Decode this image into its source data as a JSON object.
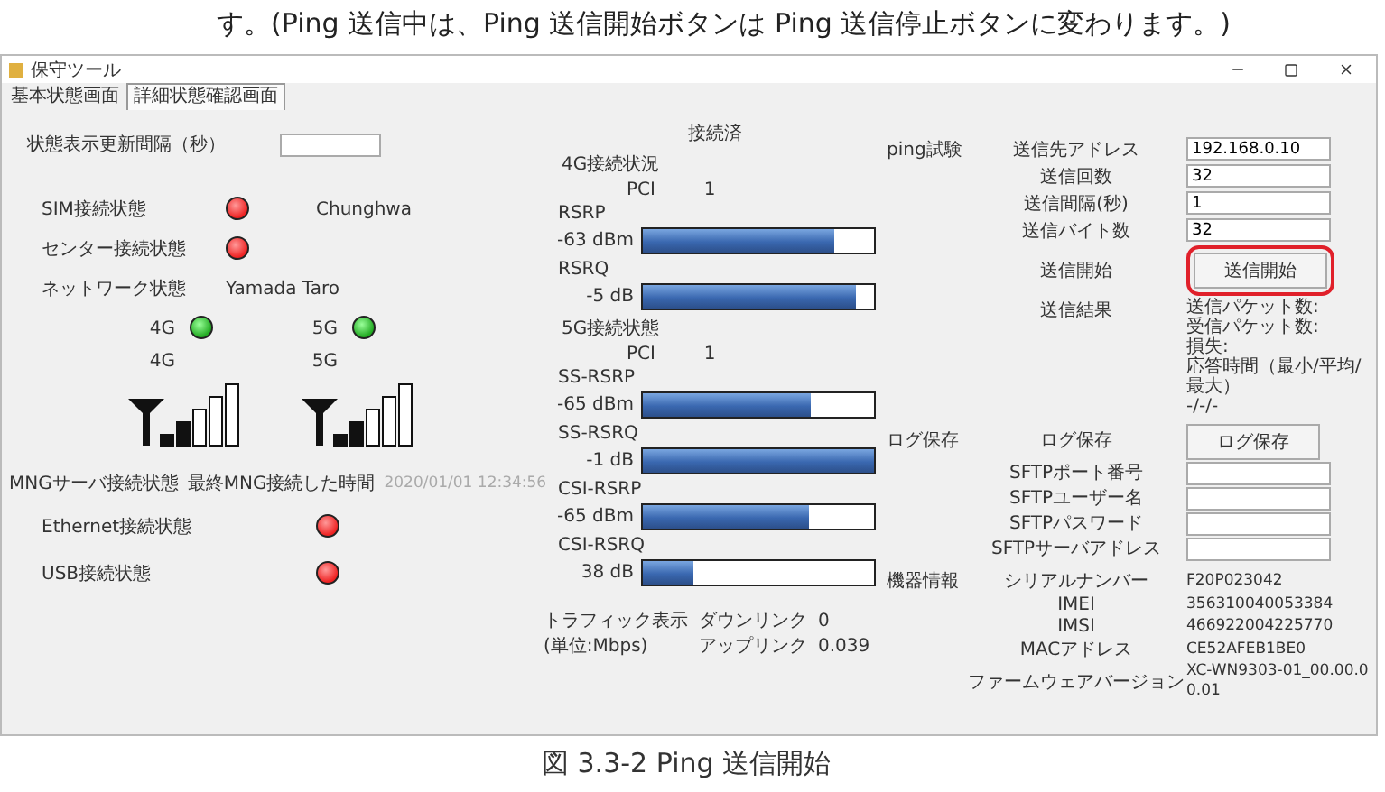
{
  "caption_top": "す。(Ping 送信中は、Ping 送信開始ボタンは Ping 送信停止ボタンに変わります。)",
  "window": {
    "title": "保守ツール"
  },
  "tabs": [
    {
      "label": "基本状態画面",
      "selected": false
    },
    {
      "label": "詳細状態確認画面",
      "selected": true
    }
  ],
  "interval": {
    "label": "状態表示更新間隔（秒）"
  },
  "status_rows": [
    {
      "kind": "lamp",
      "label": "SIM接続状態",
      "on": false,
      "value": "Chunghwa"
    },
    {
      "kind": "lamp",
      "label": "センター接続状態",
      "on": false
    },
    {
      "kind": "text",
      "label": "ネットワーク状態",
      "value": "Yamada Taro"
    }
  ],
  "bands": [
    {
      "label": "4G",
      "on": true,
      "caption": "4G"
    },
    {
      "label": "5G",
      "on": true,
      "caption": "5G"
    }
  ],
  "mng": {
    "label": "MNGサーバ接続状態",
    "time_label": "最終MNG接続した時間",
    "time": "2020/01/01 12:34:56"
  },
  "links": [
    {
      "label": "Ethernet接続状態",
      "on": false
    },
    {
      "label": "USB接続状態",
      "on": false
    }
  ],
  "connection": {
    "status": "接続済",
    "groups": [
      {
        "title": "4G接続状況",
        "pci_label": "PCI",
        "pci": "1",
        "meters": [
          {
            "name": "RSRP",
            "reading": "-63 dBm",
            "level": 0.83
          },
          {
            "name": "RSRQ",
            "reading": "-5 dB",
            "level": 0.92
          }
        ]
      },
      {
        "title": "5G接続状態",
        "pci_label": "PCI",
        "pci": "1",
        "meters": [
          {
            "name": "SS-RSRP",
            "reading": "-65 dBm",
            "level": 0.73
          },
          {
            "name": "SS-RSRQ",
            "reading": "-1 dB",
            "level": 1
          },
          {
            "name": "CSI-RSRP",
            "reading": "-65 dBm",
            "level": 0.72
          },
          {
            "name": "CSI-RSRQ",
            "reading": "38 dB",
            "level": 0.22
          }
        ]
      }
    ]
  },
  "traffic": {
    "title": "トラフィック表示",
    "unit": "(単位:Mbps)",
    "rows": [
      {
        "label": "ダウンリンク",
        "value": "0"
      },
      {
        "label": "アップリンク",
        "value": "0.039"
      }
    ]
  },
  "ping": {
    "title": "ping試験",
    "fields": [
      {
        "label": "送信先アドレス",
        "value": "192.168.0.10"
      },
      {
        "label": "送信回数",
        "value": "32"
      },
      {
        "label": "送信間隔(秒)",
        "value": "1"
      },
      {
        "label": "送信バイト数",
        "value": "32"
      }
    ],
    "start_label": "送信開始",
    "button": "送信開始",
    "highlighted": true,
    "result_label": "送信結果",
    "results": [
      "送信パケット数:",
      "受信パケット数:",
      "損失:",
      "応答時間（最小/平均/最大）",
      "-/-/-"
    ]
  },
  "log": {
    "title": "ログ保存",
    "label": "ログ保存",
    "button": "ログ保存",
    "fields": [
      {
        "label": "SFTPポート番号"
      },
      {
        "label": "SFTPユーザー名"
      },
      {
        "label": "SFTPパスワード"
      },
      {
        "label": "SFTPサーバアドレス"
      }
    ]
  },
  "device": {
    "title": "機器情報",
    "rows": [
      {
        "label": "シリアルナンバー",
        "value": "F20P023042"
      },
      {
        "label": "IMEI",
        "value": "356310040053384"
      },
      {
        "label": "IMSI",
        "value": "466922004225770"
      },
      {
        "label": "MACアドレス",
        "value": "CE52AFEB1BE0"
      },
      {
        "label": "ファームウェアバージョン",
        "value": "XC-WN9303-01_00.00.00.01"
      }
    ]
  },
  "figure_caption": "図 3.3-2 Ping 送信開始"
}
